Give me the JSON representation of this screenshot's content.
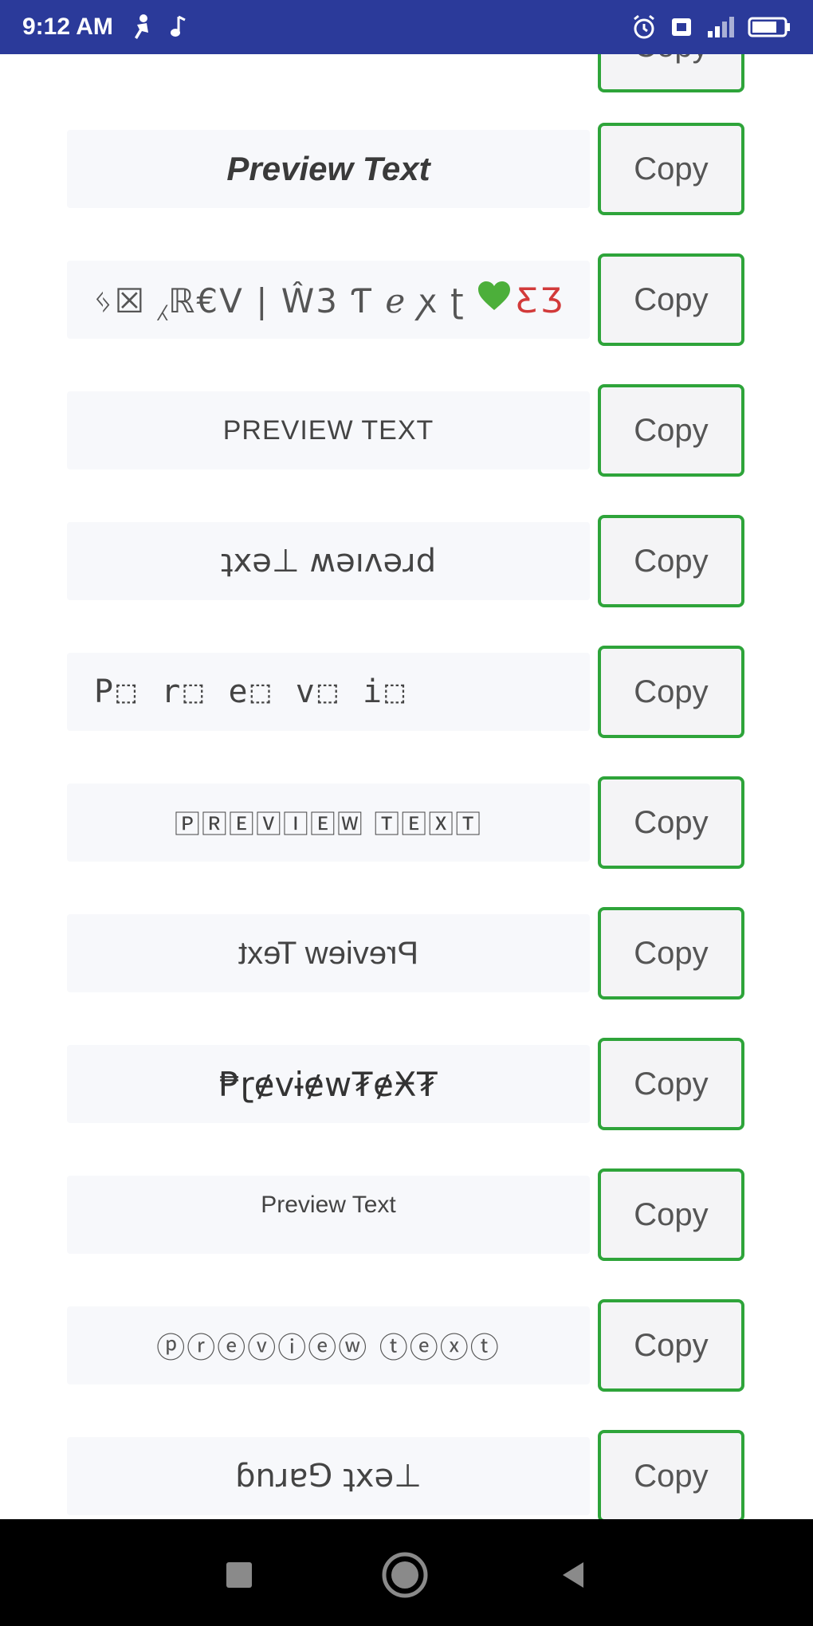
{
  "status_bar": {
    "time": "9:12 AM",
    "icons_left": [
      "person-icon",
      "music-note-icon"
    ],
    "icons_right": [
      "alarm-icon",
      "sim-icon",
      "signal-icon",
      "battery-icon"
    ]
  },
  "copy_label": "Copy",
  "rows": [
    {
      "preview": "",
      "style": "partial"
    },
    {
      "preview": "Preview Text",
      "style": "italic-bold"
    },
    {
      "preview": "ᛃ☒ ⁁ℝ€Ⅴ | Ŵ3 Ƭ ℯ ꭗ ʈ",
      "style": "fancy"
    },
    {
      "preview": "PREVIEW TEXT",
      "style": "caps"
    },
    {
      "preview": "ʇxǝ⊥ ʍǝıʌǝɹd",
      "style": "upside-down"
    },
    {
      "preview": "P⬚ r⬚ e⬚ v⬚ i⬚",
      "style": "boxes"
    },
    {
      "preview": "🄿🅁🄴🅅🄸🄴🅆 🅃🄴🅇🅃",
      "style": "squares"
    },
    {
      "preview": "Preview Text",
      "style": "mirror"
    },
    {
      "preview": "₱ɽɇvɨɇw₮ɇӾ₮",
      "style": "glitch"
    },
    {
      "preview": "Preview Text",
      "style": "small"
    },
    {
      "preview": "ⓟⓡⓔⓥⓘⓔⓦ ⓣⓔⓧⓣ",
      "style": "circles"
    },
    {
      "preview": "ɓnɹɐ⅁ ʇxǝ⊥",
      "style": "reverse"
    }
  ],
  "colors": {
    "status_bar": "#2b3a9a",
    "copy_border": "#2ea43a",
    "preview_bg": "#f7f8fb",
    "nav_bar": "#000000"
  }
}
